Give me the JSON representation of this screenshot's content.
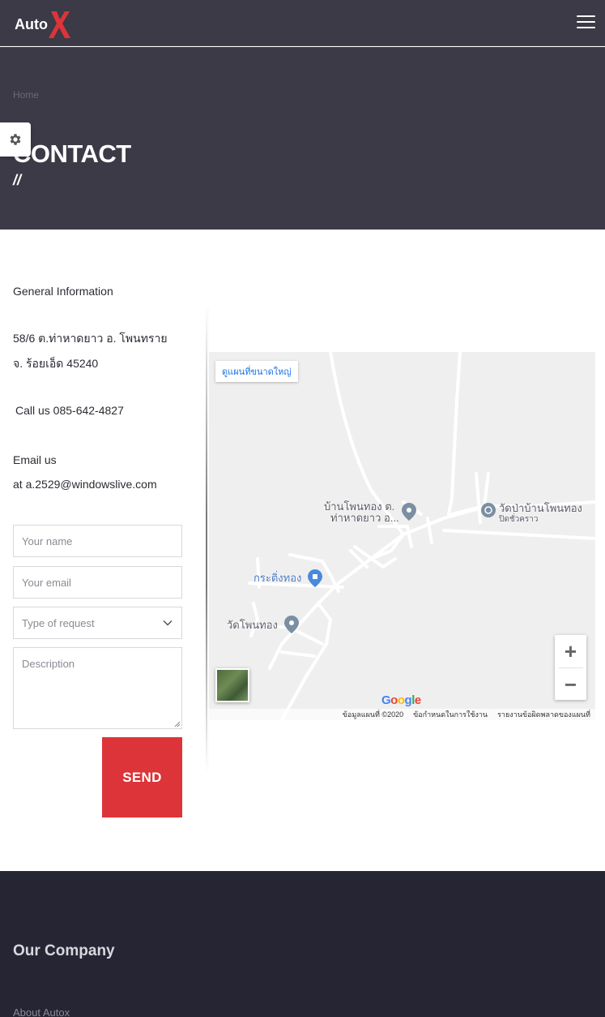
{
  "header": {
    "logo_text": "Auto",
    "logo_mark": "X",
    "menu_icon": "hamburger-icon"
  },
  "hero": {
    "breadcrumb": "Home",
    "title": "CONTACT",
    "decoration": "//"
  },
  "settings": {
    "icon": "gear-icon"
  },
  "info": {
    "heading": "General Information",
    "address_line1": "58/6 ต.ท่าหาดยาว อ. โพนทราย",
    "address_line2": "จ. ร้อยเอ็ด 45240",
    "call": "Call us 085-642-4827",
    "email_label": "Email us",
    "email_value": "at a.2529@windowslive.com"
  },
  "form": {
    "name_placeholder": "Your name",
    "email_placeholder": "Your email",
    "request_placeholder": "Type of request",
    "description_placeholder": "Description",
    "send_label": "SEND"
  },
  "map": {
    "view_larger": "ดูแผนที่ขนาดใหญ่",
    "label_village": "บ้านโพนทอง ต.",
    "label_village2": "ท่าหาดยาว อ...",
    "label_temple_east": "วัดป่าบ้านโพนทอง",
    "label_temple_east2": "ปิดชั่วคราว",
    "label_shop": "กระติ่งทอง",
    "label_temple_west": "วัดโพนทอง",
    "zoom_in": "+",
    "zoom_out": "−",
    "google": "Google",
    "footer_data": "ข้อมูลแผนที่ ©2020",
    "footer_terms": "ข้อกำหนดในการใช้งาน",
    "footer_report": "รายงานข้อผิดพลาดของแผนที่",
    "colors": {
      "accent": "#1a73e8"
    }
  },
  "footer": {
    "heading": "Our Company",
    "link_about": "About Autox"
  },
  "colors": {
    "header_bg": "#3b3a46",
    "footer_bg": "#262533",
    "send_button": "#dc3438",
    "logo_x": "#dc3438"
  }
}
